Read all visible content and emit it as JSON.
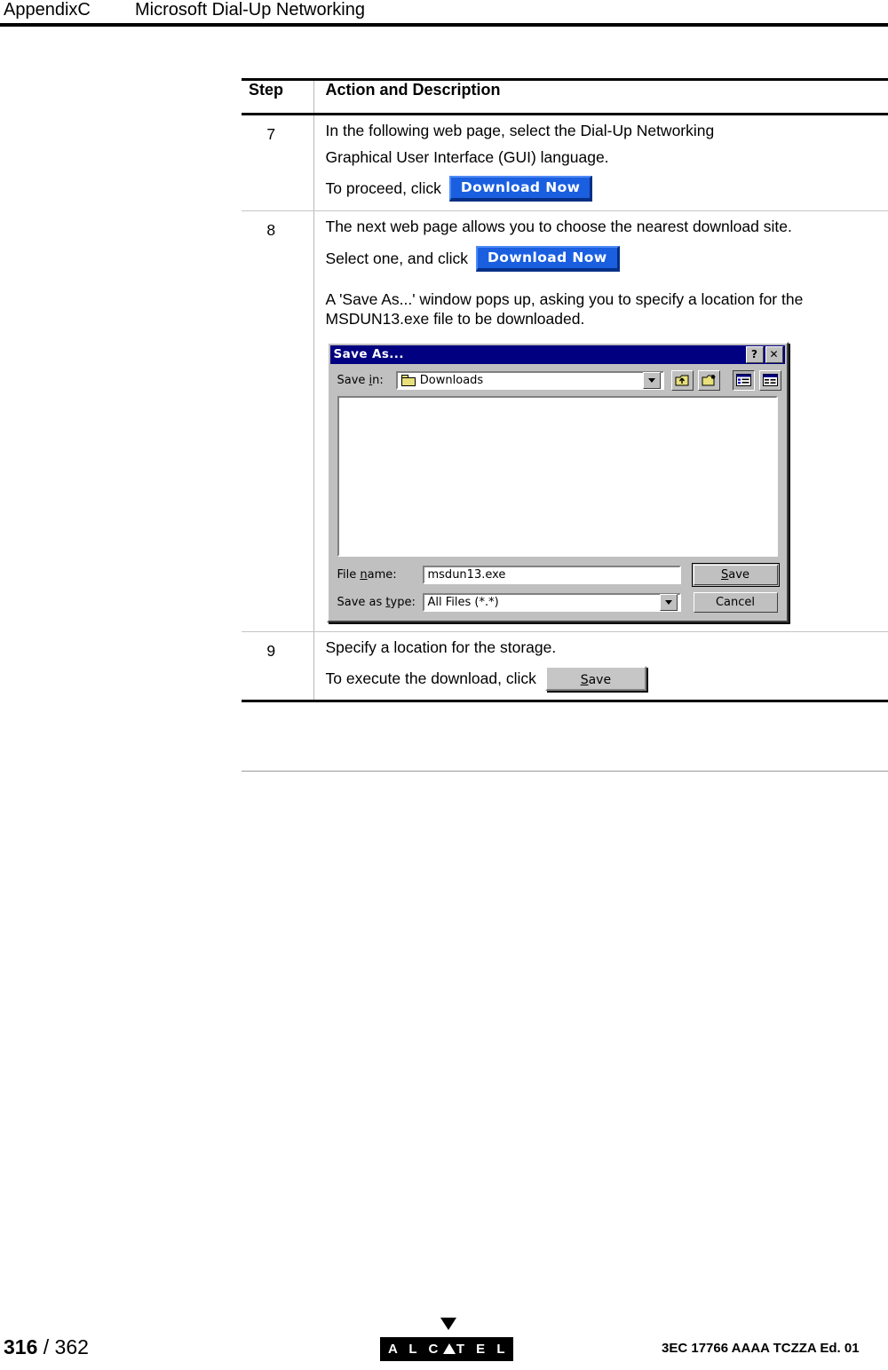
{
  "header": {
    "appendix": "AppendixC",
    "title": "Microsoft Dial-Up Networking"
  },
  "table": {
    "columns": [
      "Step",
      "Action and Description"
    ],
    "rows": [
      {
        "step": "7",
        "lines": [
          "In the following web page, select the  Dial-Up Networking",
          "Graphical User Interface (GUI) language.",
          "To proceed, click"
        ],
        "button_label": "Download Now"
      },
      {
        "step": "8",
        "line1": "The next web page allows you to choose the nearest download site.",
        "line2": "Select one, and click",
        "button_label": "Download Now",
        "para": "A 'Save As...' window pops up, asking you to specify a location for the MSDUN13.exe file to be downloaded."
      },
      {
        "step": "9",
        "line1": "Specify a location for the storage.",
        "line2": "To execute the download, click",
        "button_label": "Save"
      }
    ]
  },
  "dialog": {
    "title": "Save As...",
    "help_button": "?",
    "close_button": "✕",
    "save_in_label_a": "Save ",
    "save_in_label_u": "i",
    "save_in_label_b": "n:",
    "save_in_value": "Downloads",
    "toolbar_icons": [
      "up-one-level-icon",
      "new-folder-icon",
      "list-view-icon",
      "details-view-icon"
    ],
    "file_name_label_a": "File ",
    "file_name_label_u": "n",
    "file_name_label_b": "ame:",
    "file_name_value": "msdun13.exe",
    "save_as_type_label_a": "Save as ",
    "save_as_type_label_u": "t",
    "save_as_type_label_b": "ype:",
    "save_as_type_value": "All Files (*.*)",
    "save_button_a": "S",
    "save_button_b": "ave",
    "cancel_button": "Cancel"
  },
  "footer": {
    "page_number": "316",
    "page_total": " / 362",
    "logo_left": "A L C",
    "logo_right": "T E L",
    "reference": "3EC 17766 AAAA TCZZA Ed. 01"
  }
}
